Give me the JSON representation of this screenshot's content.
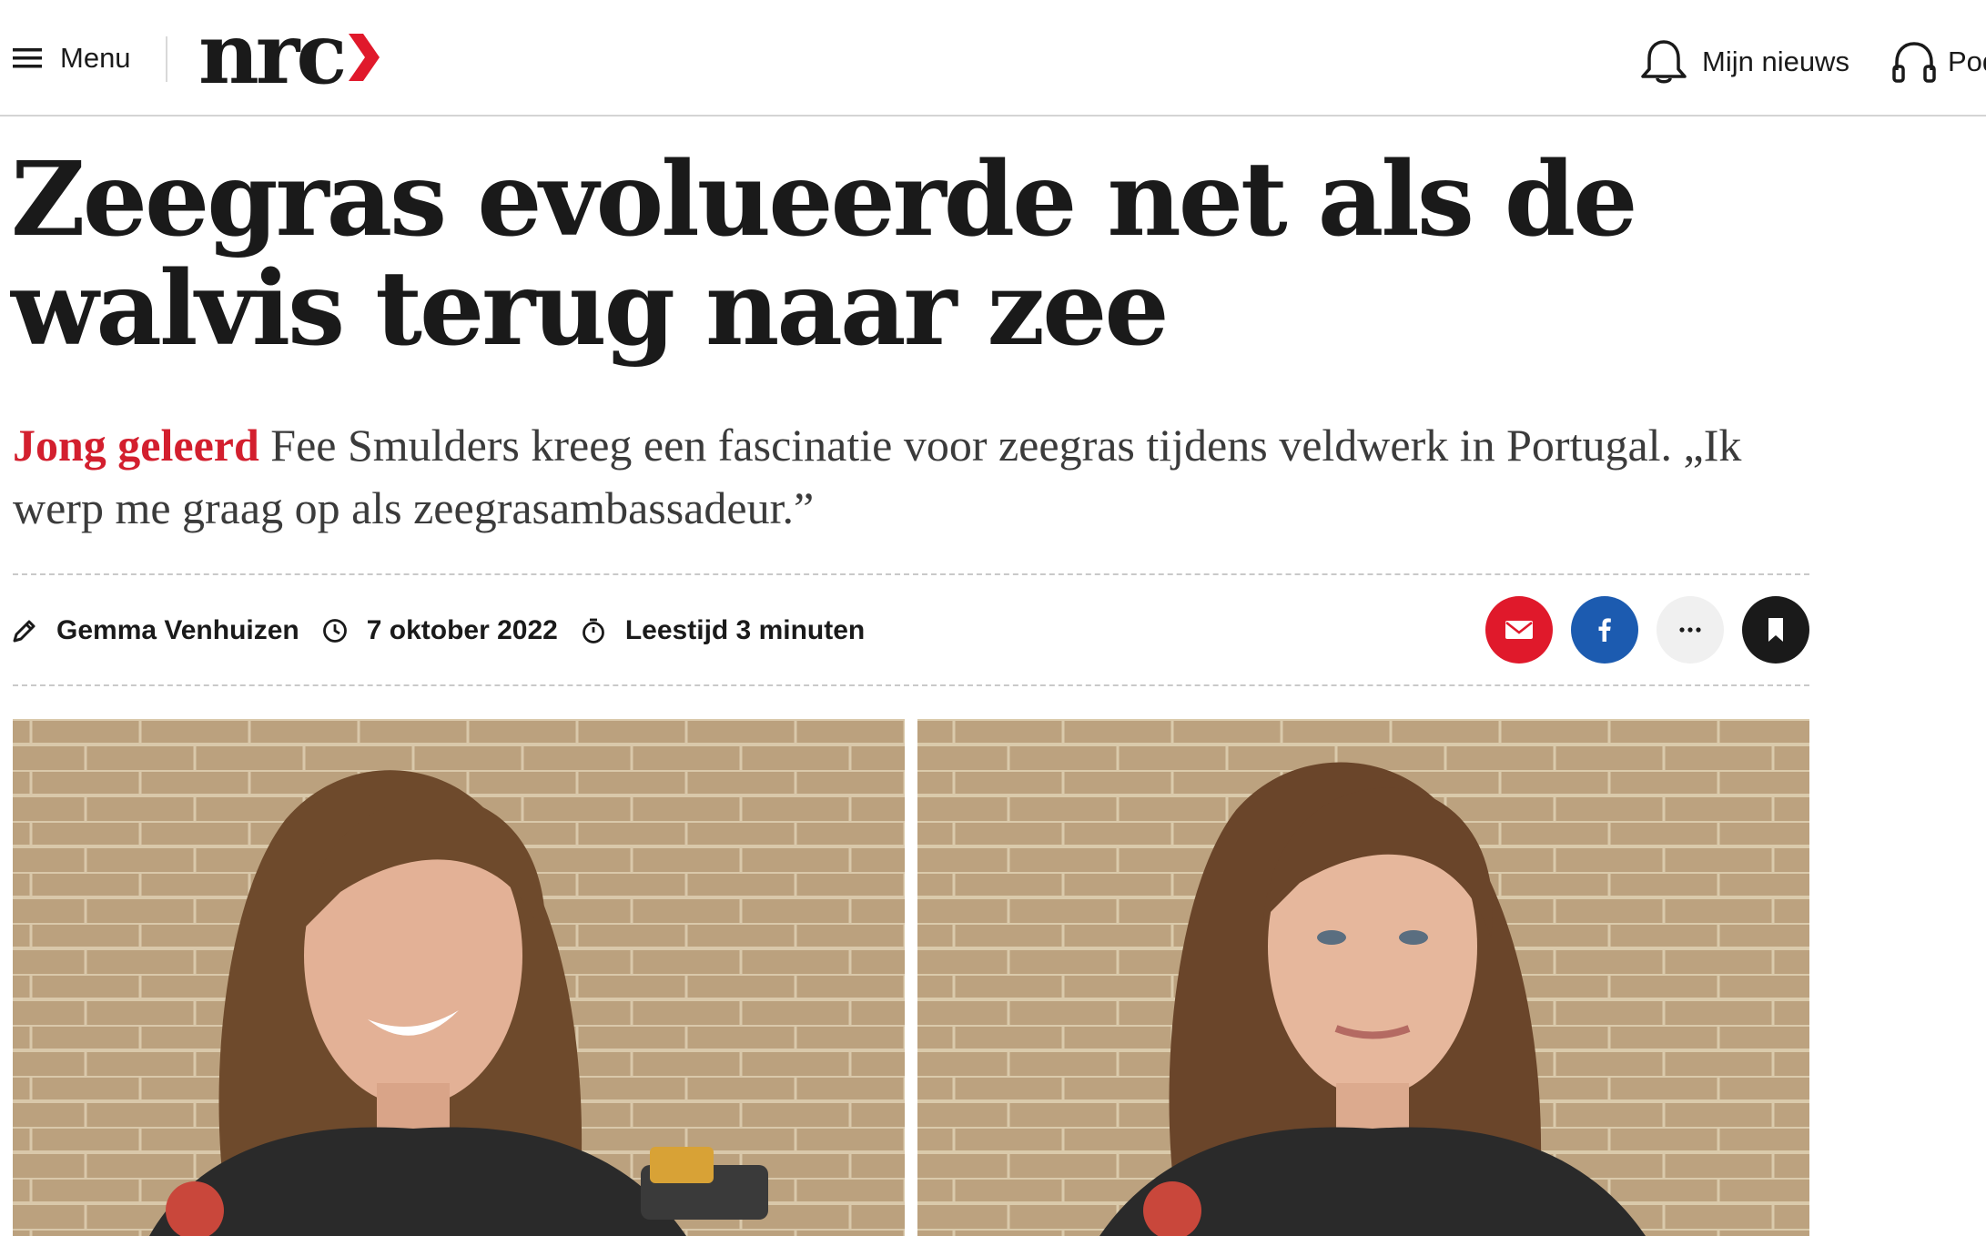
{
  "header": {
    "menu_label": "Menu",
    "logo_text": "nrc",
    "my_news_label": "Mijn nieuws",
    "podcast_label": "Podcasts",
    "brand_color": "#e0192b"
  },
  "article": {
    "headline": "Zeegras evolueerde net als de walvis terug naar zee",
    "section_label": "Jong geleerd",
    "lead": "Fee Smulders kreeg een fascinatie voor zeegras tijdens veldwerk in Portugal. „Ik werp me graag op als zeegrasambassadeur.”",
    "author": "Gemma Venhuizen",
    "date": "7 oktober 2022",
    "reading_time": "Leestijd 3 minuten"
  },
  "icons": {
    "menu": "hamburger-icon",
    "bell": "bell-icon",
    "headphones": "headphones-icon",
    "author": "pencil-icon",
    "date": "clock-icon",
    "reading": "stopwatch-icon",
    "mail": "mail-icon",
    "facebook": "facebook-icon",
    "more": "ellipsis-icon",
    "save": "bookmark-icon"
  },
  "share_colors": {
    "mail": "#e0192b",
    "facebook": "#1c5bb0",
    "more": "#f0f0f0",
    "save": "#1a1a1a"
  }
}
